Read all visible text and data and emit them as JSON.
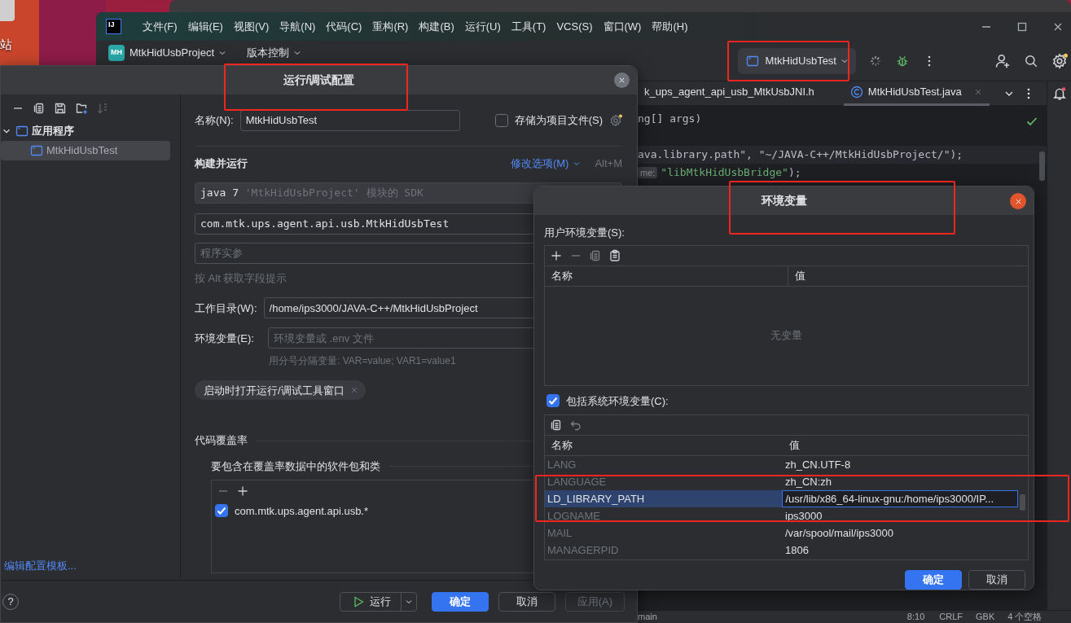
{
  "desktop": {
    "icon_label": "站"
  },
  "ide": {
    "logo": "IJ",
    "menu": [
      "文件(F)",
      "编辑(E)",
      "视图(V)",
      "导航(N)",
      "代码(C)",
      "重构(R)",
      "构建(B)",
      "运行(U)",
      "工具(T)",
      "VCS(S)",
      "窗口(W)",
      "帮助(H)"
    ],
    "project": {
      "badge": "MH",
      "name": "MtkHidUsbProject"
    },
    "vcs": "版本控制",
    "run_config": "MtkHidUsbTest",
    "editor_tabs": [
      {
        "label": "k_ups_agent_api_usb_MtkUsbJNI.h",
        "selected": false
      },
      {
        "label": "MtkHidUsbTest.java",
        "selected": true
      }
    ],
    "code_lines": [
      {
        "kind": "code",
        "caret_line": false,
        "segments": [
          {
            "kind": "plain",
            "text": "ng[] args)"
          }
        ]
      },
      {
        "kind": "blank"
      },
      {
        "kind": "code",
        "caret_line": true,
        "segments": [
          {
            "kind": "plain",
            "text": "ava.library.path\", \"~/JAVA-C++/MtkHidUsbProject/\");"
          }
        ]
      },
      {
        "kind": "code",
        "caret_line": false,
        "segments": [
          {
            "kind": "hint",
            "text": "me:"
          },
          {
            "kind": "string",
            "text": "\"libMtkHidUsbBridge\""
          },
          {
            "kind": "plain",
            "text": ");"
          }
        ]
      }
    ],
    "status_bar": [
      "main",
      "8:10",
      "CRLF",
      "GBK",
      "4 个空格"
    ]
  },
  "run_config_dialog": {
    "title": "运行/调试配置",
    "tree": [
      {
        "label": "应用程序",
        "expanded": true,
        "selected": false,
        "children": [
          {
            "label": "MtkHidUsbTest",
            "selected": true
          }
        ]
      }
    ],
    "templates_link": "编辑配置模板...",
    "help": "?",
    "name_label": "名称(N):",
    "name_value": "MtkHidUsbTest",
    "store_as_file": {
      "label": "存储为项目文件(S)",
      "checked": false
    },
    "section_title": "构建并运行",
    "modify_options": "修改选项(M)",
    "modify_shortcut": "Alt+M",
    "sdk": {
      "version": "java 7",
      "detail": "'MtkHidUsbProject' 模块的 SDK"
    },
    "main_class": "com.mtk.ups.agent.api.usb.MtkHidUsbTest",
    "program_args": {
      "placeholder": "程序实参"
    },
    "field_hint": "按 Alt 获取字段提示",
    "working_dir": {
      "label": "工作目录(W):",
      "value": "/home/ips3000/JAVA-C++/MtkHidUsbProject"
    },
    "env_vars": {
      "label": "环境变量(E):",
      "placeholder": "环境变量或 .env 文件",
      "hint": "用分号分隔变量: VAR=value; VAR1=value1"
    },
    "option_chip": "启动时打开运行/调试工具窗口",
    "coverage": {
      "title": "代码覆盖率",
      "subtitle": "要包含在覆盖率数据中的软件包和类",
      "items": [
        {
          "label": "com.mtk.ups.agent.api.usb.*",
          "checked": true
        }
      ]
    },
    "buttons": [
      {
        "label": "运行",
        "kind": "run",
        "disabled": false
      },
      {
        "label": "确定",
        "kind": "primary",
        "disabled": false
      },
      {
        "label": "取消",
        "kind": "plain",
        "disabled": false
      },
      {
        "label": "应用(A)",
        "kind": "plain",
        "disabled": true
      }
    ]
  },
  "env_dialog": {
    "title": "环境变量",
    "user_label": "用户环境变量(S):",
    "user_columns": [
      "名称",
      "值"
    ],
    "user_empty": "无变量",
    "include_system": {
      "label": "包括系统环境变量(C):",
      "checked": true
    },
    "system_columns": [
      "名称",
      "值"
    ],
    "system_rows": [
      {
        "name": "LANG",
        "value": "zh_CN.UTF-8",
        "selected": false,
        "editing": false
      },
      {
        "name": "LANGUAGE",
        "value": "zh_CN:zh",
        "selected": false,
        "editing": false
      },
      {
        "name": "LD_LIBRARY_PATH",
        "value": "/usr/lib/x86_64-linux-gnu:/home/ips3000/IP...",
        "selected": true,
        "editing": true
      },
      {
        "name": "LOGNAME",
        "value": "ips3000",
        "selected": false,
        "editing": false
      },
      {
        "name": "MAIL",
        "value": "/var/spool/mail/ips3000",
        "selected": false,
        "editing": false
      },
      {
        "name": "MANAGERPID",
        "value": "1806",
        "selected": false,
        "editing": false
      }
    ],
    "buttons": [
      {
        "label": "确定",
        "kind": "primary",
        "disabled": false
      },
      {
        "label": "取消",
        "kind": "plain",
        "disabled": false
      }
    ]
  }
}
